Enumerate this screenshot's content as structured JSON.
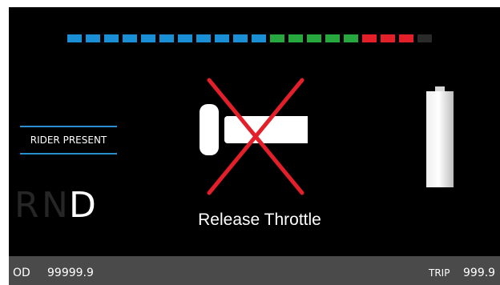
{
  "display": {
    "background": "#000000",
    "status_bar_color": "#4a4a4a"
  },
  "power_meter": {
    "segments": [
      {
        "color": "#1a8fd6"
      },
      {
        "color": "#1a8fd6"
      },
      {
        "color": "#1a8fd6"
      },
      {
        "color": "#1a8fd6"
      },
      {
        "color": "#1a8fd6"
      },
      {
        "color": "#1a8fd6"
      },
      {
        "color": "#1a8fd6"
      },
      {
        "color": "#1a8fd6"
      },
      {
        "color": "#1a8fd6"
      },
      {
        "color": "#1a8fd6"
      },
      {
        "color": "#1a8fd6"
      },
      {
        "color": "#27a83e"
      },
      {
        "color": "#27a83e"
      },
      {
        "color": "#27a83e"
      },
      {
        "color": "#27a83e"
      },
      {
        "color": "#27a83e"
      },
      {
        "color": "#e3202a"
      },
      {
        "color": "#e3202a"
      },
      {
        "color": "#e3202a"
      },
      {
        "color": "#2a2a2a"
      }
    ]
  },
  "rider_status": {
    "label": "RIDER PRESENT",
    "line_color": "#2a8fd0"
  },
  "gear_selector": {
    "gears": [
      {
        "label": "R",
        "active": false
      },
      {
        "label": "N",
        "active": false
      },
      {
        "label": "D",
        "active": true
      }
    ],
    "active_color": "#ffffff",
    "inactive_color": "#262626"
  },
  "throttle_warning": {
    "icon": "throttle-crossed-icon",
    "message": "Release Throttle",
    "cross_color": "#e3202a"
  },
  "battery": {
    "icon": "battery-icon",
    "level": 1.0
  },
  "odometer": {
    "label": "OD",
    "value": "99999.9"
  },
  "trip": {
    "label": "TRIP",
    "value": "999.9"
  }
}
